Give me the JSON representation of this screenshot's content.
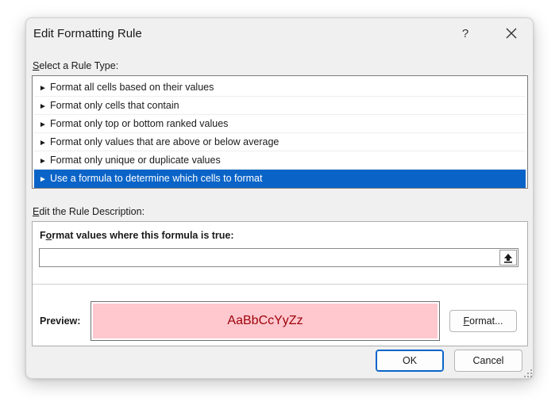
{
  "dialog": {
    "title": "Edit Formatting Rule",
    "help_glyph": "?",
    "close_glyph": "✕"
  },
  "rule_type": {
    "label_accel": "S",
    "label_rest": "elect a Rule Type:",
    "selected_index": 5,
    "items": [
      {
        "arrow": "►",
        "label": "Format all cells based on their values"
      },
      {
        "arrow": "►",
        "label": "Format only cells that contain"
      },
      {
        "arrow": "►",
        "label": "Format only top or bottom ranked values"
      },
      {
        "arrow": "►",
        "label": "Format only values that are above or below average"
      },
      {
        "arrow": "►",
        "label": "Format only unique or duplicate values"
      },
      {
        "arrow": "►",
        "label": "Use a formula to determine which cells to format"
      }
    ]
  },
  "description": {
    "label_accel": "E",
    "label_rest": "dit the Rule Description:",
    "formula_label_pre": "F",
    "formula_label_accel": "o",
    "formula_label_rest": "rmat values where this formula is true:",
    "formula_value": "",
    "preview_label": "Preview:",
    "preview_text": "AaBbCcYyZz",
    "preview_fill": "#ffc7ce",
    "preview_font_color": "#9c0006"
  },
  "buttons": {
    "format_accel": "F",
    "format_rest": "ormat...",
    "ok": "OK",
    "cancel": "Cancel"
  },
  "colors": {
    "selection": "#0a64c8",
    "dialog_bg": "#f0f0f0"
  }
}
